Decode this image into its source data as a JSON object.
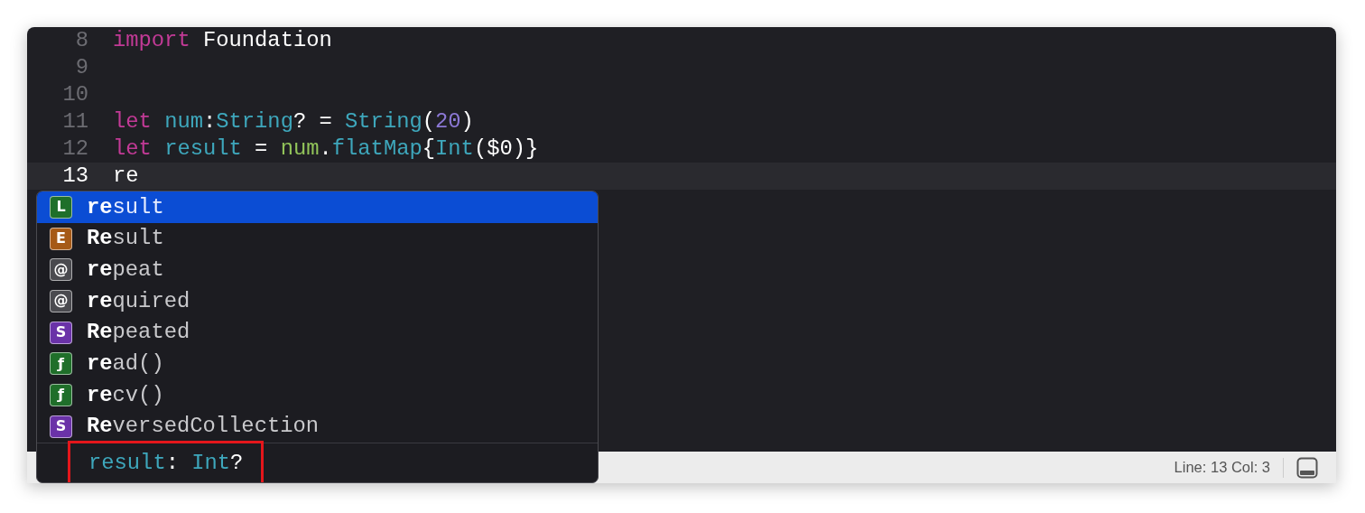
{
  "editor": {
    "lines": [
      {
        "number": "8",
        "current": false,
        "tokens": [
          {
            "kind": "keyword",
            "text": "import"
          },
          {
            "kind": "plain",
            "text": " Foundation"
          }
        ]
      },
      {
        "number": "9",
        "current": false
      },
      {
        "number": "10",
        "current": false
      },
      {
        "number": "11",
        "current": false,
        "tokens": [
          {
            "kind": "keyword",
            "text": "let "
          },
          {
            "kind": "decl",
            "text": "num"
          },
          {
            "kind": "plain",
            "text": ":"
          },
          {
            "kind": "type",
            "text": "String"
          },
          {
            "kind": "plain",
            "text": "? = "
          },
          {
            "kind": "type",
            "text": "String"
          },
          {
            "kind": "plain",
            "text": "("
          },
          {
            "kind": "number",
            "text": "20"
          },
          {
            "kind": "plain",
            "text": ")"
          }
        ]
      },
      {
        "number": "12",
        "current": false,
        "tokens": [
          {
            "kind": "keyword",
            "text": "let "
          },
          {
            "kind": "decl",
            "text": "result"
          },
          {
            "kind": "plain",
            "text": " = "
          },
          {
            "kind": "var",
            "text": "num"
          },
          {
            "kind": "plain",
            "text": "."
          },
          {
            "kind": "type",
            "text": "flatMap"
          },
          {
            "kind": "plain",
            "text": "{"
          },
          {
            "kind": "type",
            "text": "Int"
          },
          {
            "kind": "plain",
            "text": "($0)}"
          }
        ]
      },
      {
        "number": "13",
        "current": true,
        "tokens": [
          {
            "kind": "plain",
            "text": "re"
          }
        ]
      }
    ]
  },
  "completion": {
    "items": [
      {
        "icon": "L",
        "color": "#1f6f2a",
        "label": "**re**sult",
        "selected": true
      },
      {
        "icon": "E",
        "color": "#a65a17",
        "label": "**Re**sult",
        "selected": false
      },
      {
        "icon": "@",
        "color": "#4a4a4f",
        "label": "**re**peat",
        "selected": false
      },
      {
        "icon": "@",
        "color": "#4a4a4f",
        "label": "**re**quired",
        "selected": false
      },
      {
        "icon": "S",
        "color": "#6a32a8",
        "label": "**Re**peated",
        "selected": false
      },
      {
        "icon": "ƒ",
        "color": "#1f6f2a",
        "label": "**re**ad()",
        "selected": false
      },
      {
        "icon": "ƒ",
        "color": "#1f6f2a",
        "label": "**re**cv()",
        "selected": false
      },
      {
        "icon": "S",
        "color": "#6a32a8",
        "label": "**Re**versedCollection",
        "selected": false
      }
    ],
    "detail": {
      "highlighted": true,
      "tokens": [
        {
          "kind": "decl",
          "text": "result"
        },
        {
          "kind": "plain",
          "text": ": "
        },
        {
          "kind": "type",
          "text": "Int"
        },
        {
          "kind": "plain",
          "text": "?"
        }
      ]
    }
  },
  "status_bar": {
    "position": "Line: 13  Col: 3"
  }
}
